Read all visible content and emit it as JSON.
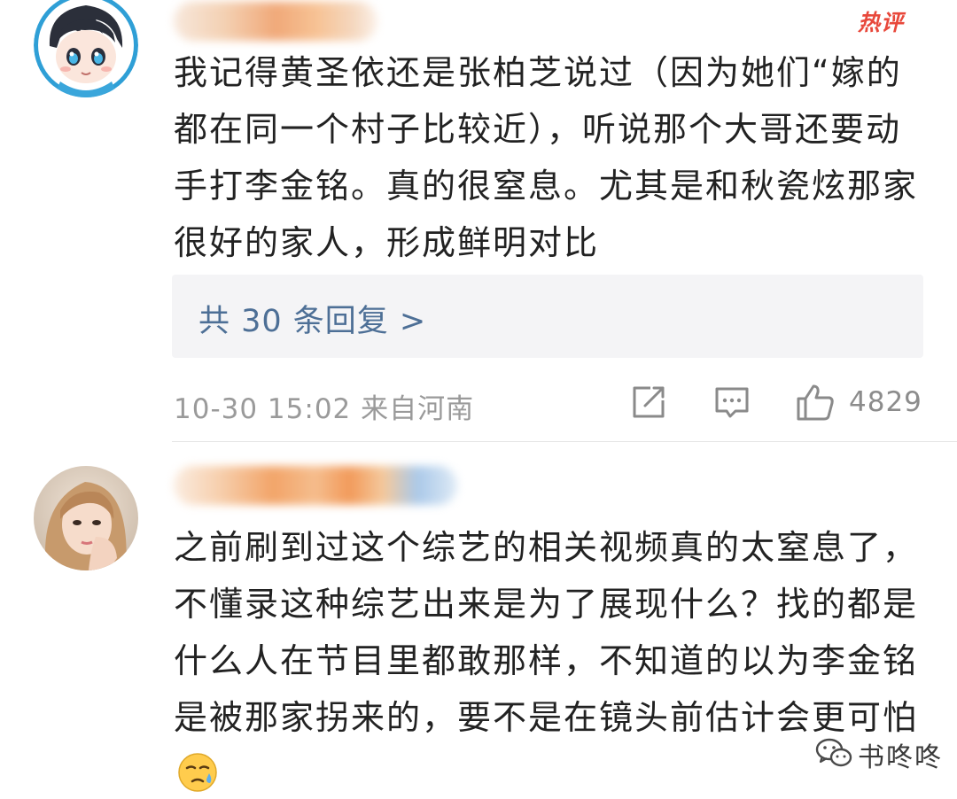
{
  "comments": [
    {
      "hot_badge": "热评",
      "text": "我记得黄圣依还是张柏芝说过（因为她们“嫁的都在同一个村子比较近），听说那个大哥还要动手打李金铭。真的很窒息。尤其是和秋瓷炫那家很好的家人，形成鲜明对比",
      "replies_link": "共 30 条回复 >",
      "time_location": "10-30 15:02 来自河南",
      "like_count": "4829",
      "icons": [
        "share-icon",
        "comment-icon",
        "like-icon"
      ]
    },
    {
      "text": "之前刷到过这个综艺的相关视频真的太窒息了，不懂录这种综艺出来是为了展现什么？找的都是什么人在节目里都敢那样，不知道的以为李金铭是被那家拐来的，要不是在镜头前估计会更可怕",
      "emoji": "cold-sweat-emoji"
    }
  ],
  "watermark": {
    "icon": "wechat-icon",
    "text": "书咚咚"
  },
  "colors": {
    "hot_badge": "#e8483b",
    "link": "#4d6f96",
    "meta": "#9a9a9a",
    "reply_bg": "#f4f4f6"
  }
}
